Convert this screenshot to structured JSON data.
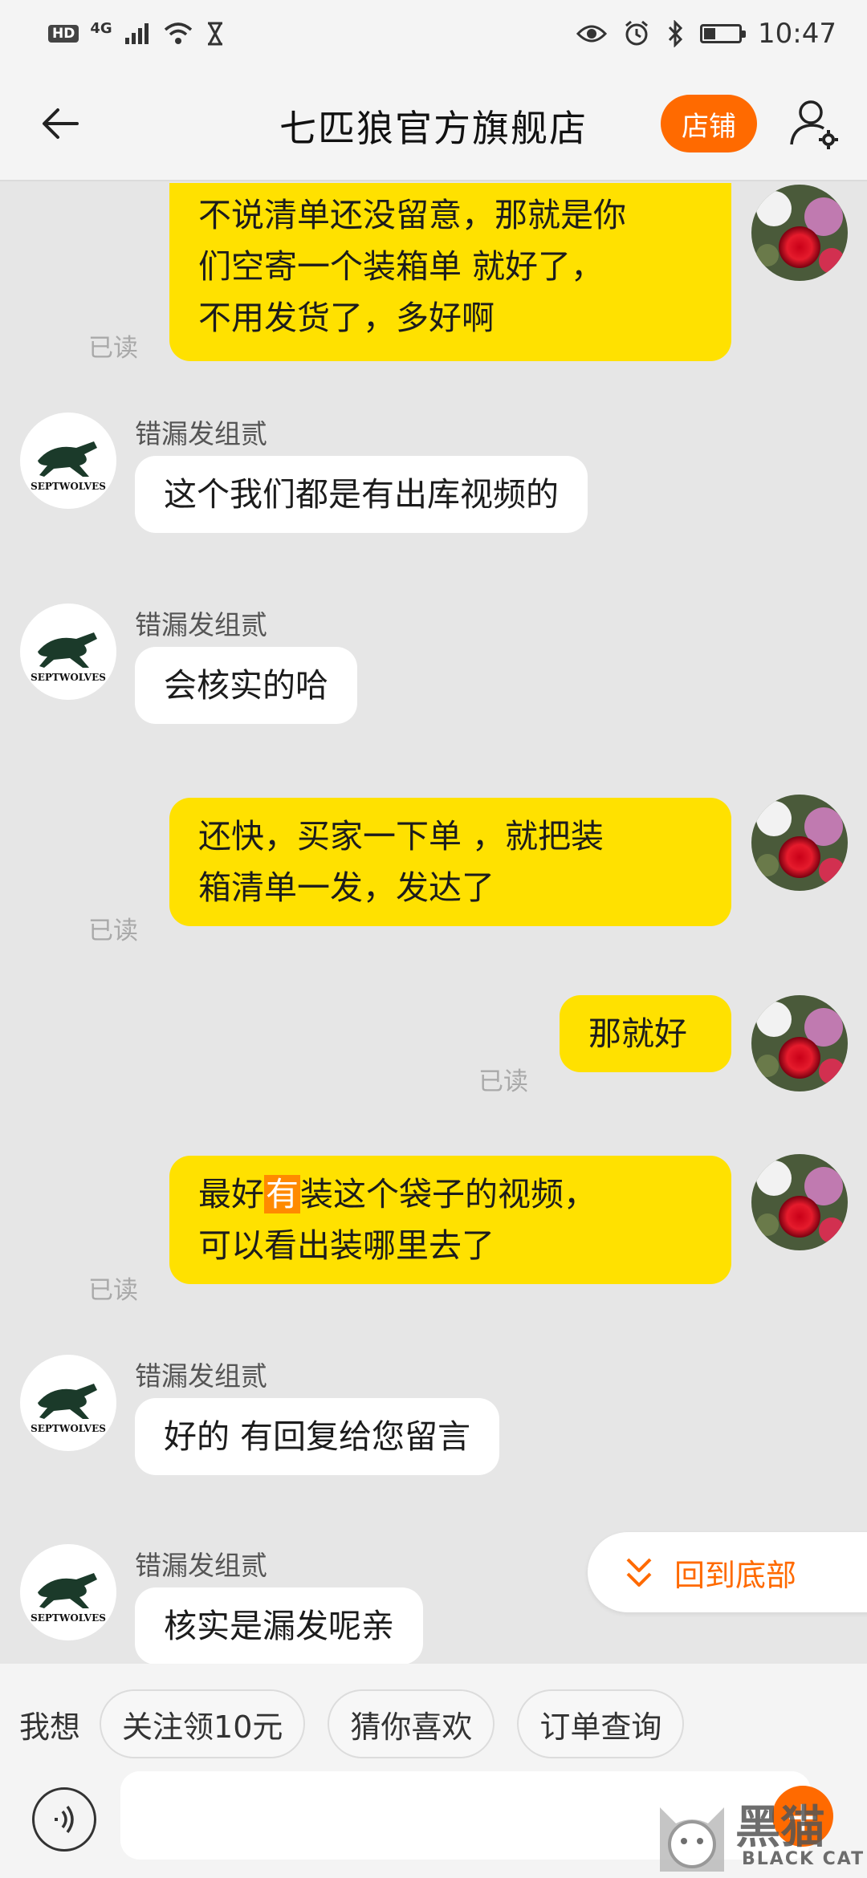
{
  "status_bar": {
    "hd": "HD",
    "network": "4G",
    "time": "10:47"
  },
  "header": {
    "title": "七匹狼官方旗舰店",
    "shop_label": "店铺"
  },
  "messages": [
    {
      "from": "me",
      "lines": [
        "不说清单还没留意，那就是你",
        "们空寄一个装箱单 就好了，",
        "不用发货了，多好啊"
      ],
      "read": "已读"
    },
    {
      "from": "them",
      "sender": "错漏发组贰",
      "text": "这个我们都是有出库视频的"
    },
    {
      "from": "them",
      "sender": "错漏发组贰",
      "text": "会核实的哈"
    },
    {
      "from": "me",
      "lines": [
        "还快，买家一下单 ，就把装",
        "箱清单一发，发达了"
      ],
      "read": "已读"
    },
    {
      "from": "me",
      "text": "那就好",
      "read": "已读"
    },
    {
      "from": "me",
      "line1_before": "最好",
      "line1_highlight": "有",
      "line1_after": "装这个袋子的视频，",
      "line2": "可以看出装哪里去了",
      "read": "已读"
    },
    {
      "from": "them",
      "sender": "错漏发组贰",
      "text": "好的 有回复给您留言"
    },
    {
      "from": "them",
      "sender": "错漏发组贰",
      "text": "核实是漏发呢亲"
    }
  ],
  "brand_logo_text": "SEPTWOLVES",
  "back_to_bottom": "回到底部",
  "quick_bar": {
    "label": "我想",
    "chips": [
      "关注领10元",
      "猜你喜欢",
      "订单查询"
    ]
  },
  "watermark": {
    "cn": "黑猫",
    "en": "BLACK CAT"
  },
  "colors": {
    "accent": "#ff6a00",
    "my_bubble": "#ffe100",
    "their_bubble": "#ffffff",
    "background": "#e6e6e6"
  }
}
